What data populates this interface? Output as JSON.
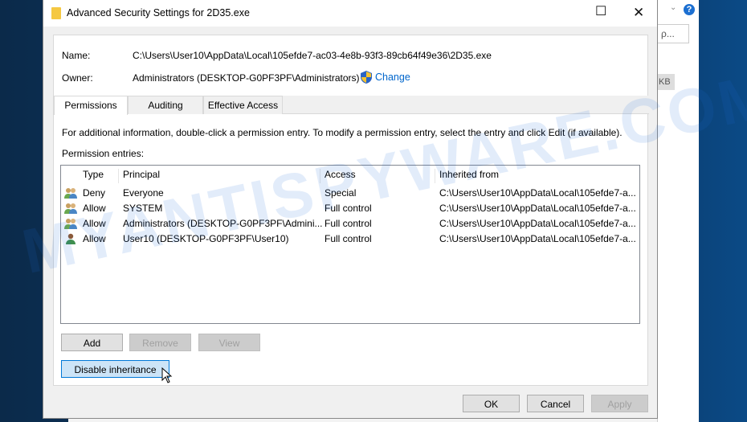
{
  "window": {
    "title": "Advanced Security Settings for 2D35.exe"
  },
  "info": {
    "name_label": "Name:",
    "name_value": "C:\\Users\\User10\\AppData\\Local\\105efde7-ac03-4e8b-93f3-89cb64f49e36\\2D35.exe",
    "owner_label": "Owner:",
    "owner_value": "Administrators (DESKTOP-G0PF3PF\\Administrators)",
    "change_link": "Change"
  },
  "tabs": [
    {
      "label": "Permissions",
      "active": true
    },
    {
      "label": "Auditing"
    },
    {
      "label": "Effective Access"
    }
  ],
  "description": "For additional information, double-click a permission entry. To modify a permission entry, select the entry and click Edit (if available).",
  "entries_label": "Permission entries:",
  "columns": [
    "Type",
    "Principal",
    "Access",
    "Inherited from"
  ],
  "rows": [
    {
      "icon": "users-group-icon",
      "type": "Deny",
      "principal": "Everyone",
      "access": "Special",
      "inherited": "C:\\Users\\User10\\AppData\\Local\\105efde7-a..."
    },
    {
      "icon": "users-group-icon",
      "type": "Allow",
      "principal": "SYSTEM",
      "access": "Full control",
      "inherited": "C:\\Users\\User10\\AppData\\Local\\105efde7-a..."
    },
    {
      "icon": "users-group-icon",
      "type": "Allow",
      "principal": "Administrators (DESKTOP-G0PF3PF\\Admini...",
      "access": "Full control",
      "inherited": "C:\\Users\\User10\\AppData\\Local\\105efde7-a..."
    },
    {
      "icon": "user-icon",
      "type": "Allow",
      "principal": "User10 (DESKTOP-G0PF3PF\\User10)",
      "access": "Full control",
      "inherited": "C:\\Users\\User10\\AppData\\Local\\105efde7-a..."
    }
  ],
  "buttons": {
    "add": "Add",
    "remove": "Remove",
    "view": "View",
    "disable_inheritance": "Disable inheritance",
    "ok": "OK",
    "cancel": "Cancel",
    "apply": "Apply"
  },
  "background": {
    "search_text": "ρ...",
    "size_text": "KB",
    "help": "?"
  },
  "watermark": "MYANTISPYWARE.COM"
}
